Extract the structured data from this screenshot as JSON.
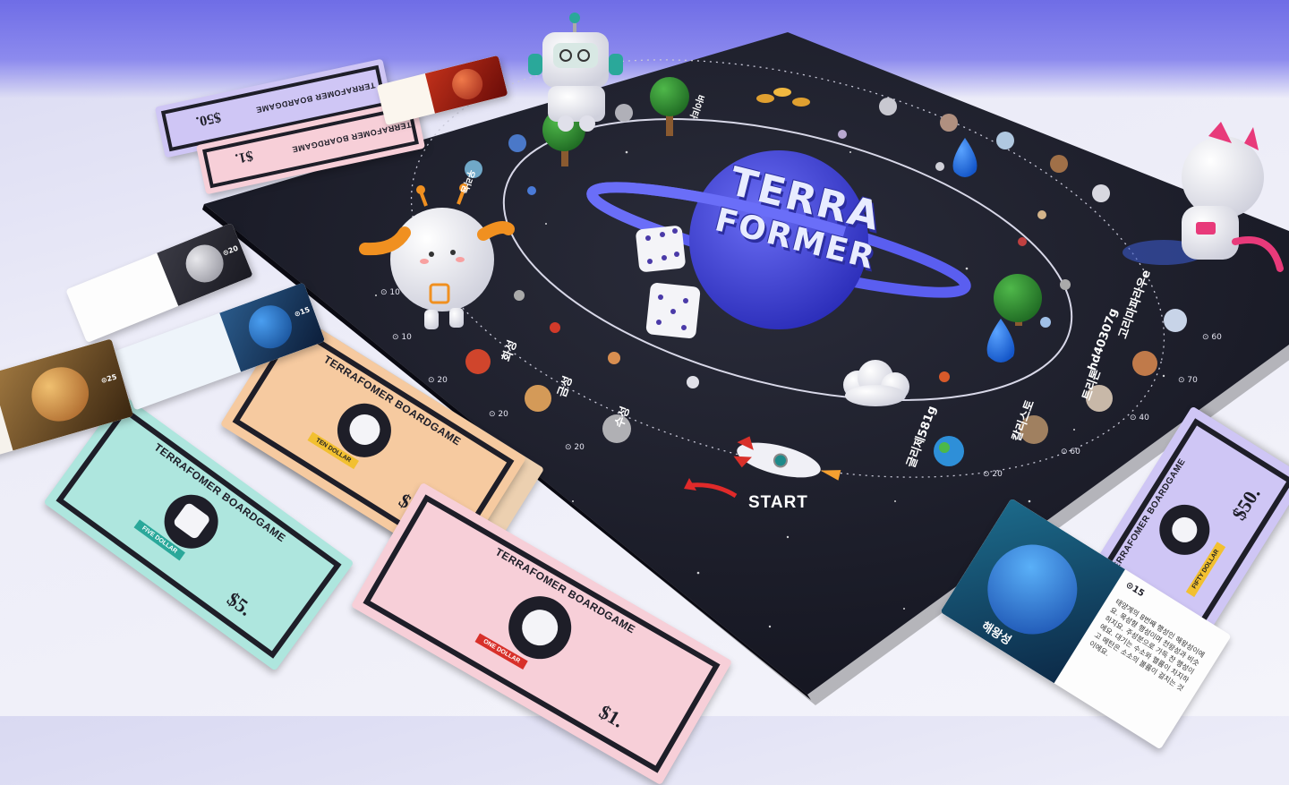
{
  "board": {
    "title_line1": "TERRA",
    "title_line2": "FORMER",
    "start_label": "START"
  },
  "planet_labels": {
    "mercury": "수성",
    "venus": "금성",
    "mars": "화성",
    "gliese": "글리제581g",
    "callisto": "칼리스토",
    "titan": "트리톤",
    "hd": "hd40307g",
    "kepler": "고리마파라우e",
    "top1": "우라늄",
    "top2": "바이타"
  },
  "space_numbers": {
    "n1": "⊙ 20",
    "n2": "⊙ 40",
    "n3": "⊙ 20",
    "n4": "⊙ 10",
    "n5": "⊙ 10",
    "n6": "⊙ 20",
    "n7": "⊙ 60",
    "n8": "⊙ 40",
    "n9": "⊙ 70",
    "n10": "⊙ 60",
    "n11": "⊙ 15"
  },
  "bills": {
    "brand": "TERRAFOMER BOARDGAME",
    "logo_small": "TERRA FORMER",
    "ten": {
      "value": "$10.",
      "ribbon": "TEN DOLLAR"
    },
    "five": {
      "value": "$5.",
      "ribbon": "FIVE DOLLAR"
    },
    "one": {
      "value": "$1.",
      "ribbon": "ONE DOLLAR"
    },
    "fifty": {
      "value": "$50.",
      "ribbon": "FIFTY DOLLAR"
    },
    "fifty_back": {
      "value": "$50."
    },
    "one_back": {
      "value": "$1."
    }
  },
  "cards": {
    "neptune": {
      "price": "⊙15",
      "name": "해왕성",
      "text": "태양계의 8번째 행성인 해왕성이에요. 목성형 행성이며 천왕성과 비슷하지요. 주성분으로 가득 찬 행성이에요. 대기는 수소와 헬륨이 차지하고 메탄은 소소의 볼륨이 걸치는 것이에요."
    },
    "moon": {
      "price": "⊙20"
    },
    "blue": {
      "price": "⊙15"
    },
    "jupiter": {
      "price": "⊙25"
    }
  },
  "colors": {
    "board": "#1c1d2a",
    "accent": "#3b3fd8",
    "bill_orange": "#f6caa0",
    "bill_mint": "#aee6de",
    "bill_pink": "#f7cfd8",
    "bill_purple": "#cfc6f5"
  }
}
